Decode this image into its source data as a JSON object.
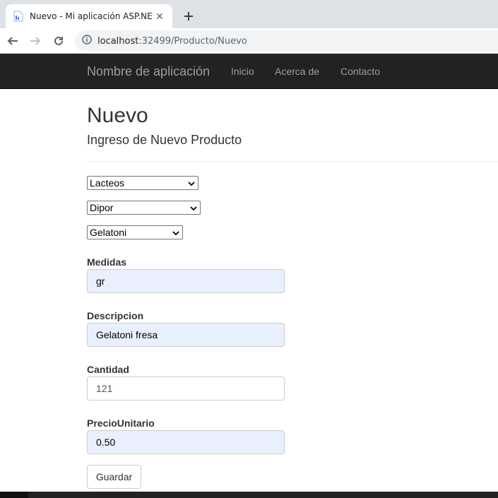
{
  "browser": {
    "tab_title": "Nuevo - Mi aplicación ASP.NET",
    "url_host": "localhost",
    "url_path": ":32499/Producto/Nuevo"
  },
  "navbar": {
    "brand": "Nombre de aplicación",
    "links": [
      "Inicio",
      "Acerca de",
      "Contacto"
    ]
  },
  "page": {
    "title": "Nuevo",
    "subtitle": "Ingreso de Nuevo Producto"
  },
  "selects": [
    {
      "selected": "Lacteos"
    },
    {
      "selected": "Dipor"
    },
    {
      "selected": "Gelatoni"
    }
  ],
  "form": {
    "fields": [
      {
        "label": "Medidas",
        "value": "gr"
      },
      {
        "label": "Descripcion",
        "value": "Gelatoni fresa"
      },
      {
        "label": "Cantidad",
        "value": "121"
      },
      {
        "label": "PrecioUnitario",
        "value": "0.50"
      }
    ],
    "submit_label": "Guardar"
  },
  "colors": {
    "navbar_bg": "#222222",
    "autofill_bg": "#e8f0fe"
  }
}
